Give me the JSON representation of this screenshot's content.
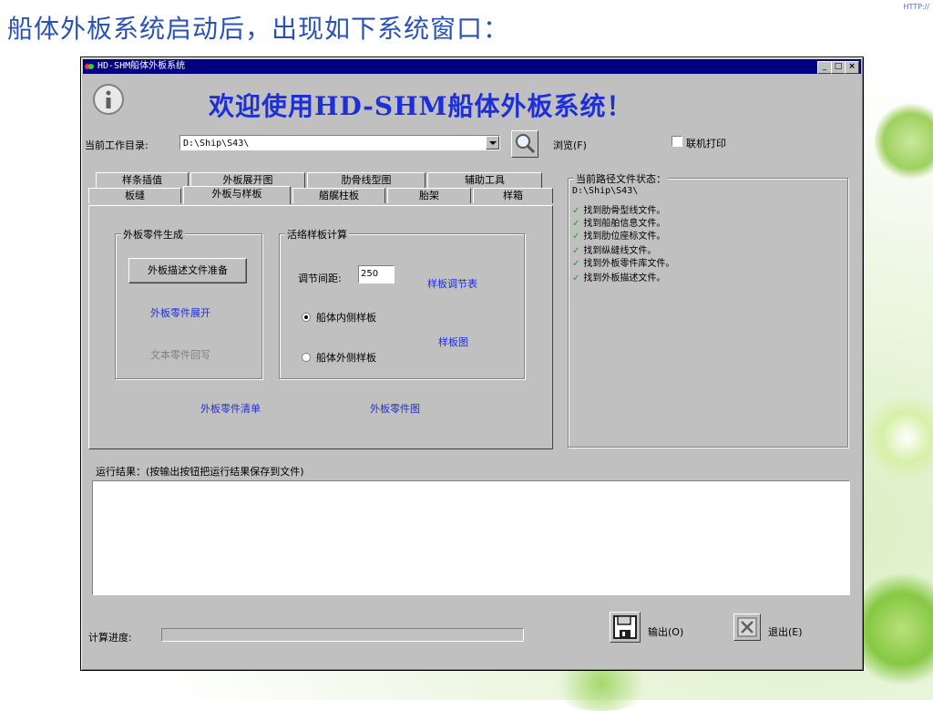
{
  "slide": {
    "title": "船体外板系统启动后，出现如下系统窗口：",
    "corner_mark": "HTTP://"
  },
  "window": {
    "title": "HD-SHM船体外板系统",
    "buttons": {
      "minimize": "_",
      "maximize": "□",
      "close": "×"
    }
  },
  "welcome": {
    "text": "欢迎使用HD-SHM船体外板系统！",
    "info_icon": "info-icon"
  },
  "workdir": {
    "label": "当前工作目录:",
    "value": "D:\\Ship\\S43\\",
    "browse_label": "浏览(F)",
    "online_print_label": "联机打印",
    "online_print_checked": false
  },
  "tabs": {
    "row1": [
      "样条插值",
      "外板展开图",
      "肋骨线型图",
      "辅助工具"
    ],
    "row2": [
      "板缝",
      "外板与样板",
      "艏艉柱板",
      "胎架",
      "样箱"
    ],
    "active": "外板与样板"
  },
  "parts_group": {
    "title": "外板零件生成",
    "prepare_button": "外板描述文件准备",
    "unfold_link": "外板零件展开",
    "writeback_disabled": "文本零件回写"
  },
  "template_group": {
    "title": "活络样板计算",
    "spacing_label": "调节间距:",
    "spacing_value": "250",
    "adjust_table_link": "样板调节表",
    "radio_inner": "船体内侧样板",
    "radio_outer": "船体外侧样板",
    "selected": "船体内侧样板",
    "template_chart_link": "样板图"
  },
  "bottom_links": {
    "parts_list": "外板零件清单",
    "parts_drawing": "外板零件图"
  },
  "status": {
    "title": "当前路径文件状态：",
    "path": "D:\\Ship\\S43\\",
    "check_mark": "✓",
    "items": [
      "找到肋骨型线文件。",
      "找到船舶信息文件。",
      "找到肋位座标文件。",
      "找到纵缝线文件。",
      "找到外板零件库文件。",
      "找到外板描述文件。"
    ]
  },
  "result": {
    "label": "运行结果：(按输出按钮把运行结果保存到文件)",
    "content": ""
  },
  "progress": {
    "label": "计算进度:",
    "value": 0
  },
  "actions": {
    "output_label": "输出(O)",
    "exit_label": "退出(E)"
  },
  "colors": {
    "accent_blue": "#1f2fd6",
    "title_bar": "#000080",
    "check_green": "#1aa31a",
    "window_gray": "#c0c0c0"
  }
}
